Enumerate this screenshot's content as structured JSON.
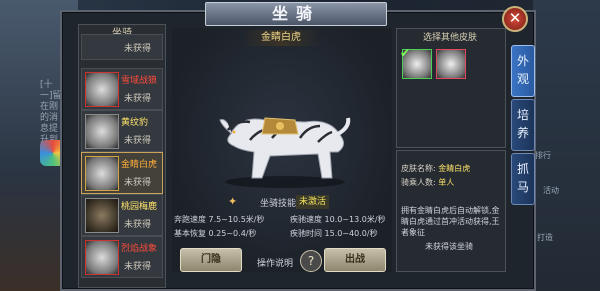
{
  "title": "坐骑",
  "close_label": "✕",
  "list": {
    "header": "坐骑",
    "items": [
      {
        "name": "",
        "status": "未获得",
        "frame": ""
      },
      {
        "name": "雪域战狼",
        "status": "未获得",
        "frame": "red",
        "name_color": "n-red"
      },
      {
        "name": "黄纹豹",
        "status": "未获得",
        "frame": "",
        "name_color": "n-yellow"
      },
      {
        "name": "金睛白虎",
        "status": "未获得",
        "frame": "gold",
        "name_color": "n-orange",
        "selected": true
      },
      {
        "name": "桃园梅鹿",
        "status": "未获得",
        "frame": "dark",
        "name_color": "n-yellow"
      },
      {
        "name": "烈焰战象",
        "status": "未获得",
        "frame": "red",
        "name_color": "n-red"
      }
    ]
  },
  "preview": {
    "mount_name": "金睛白虎",
    "skill_label": "坐骑技能",
    "skill_state": "未激活"
  },
  "stats": {
    "run_speed": "奔跑速度 7.5~10.5米/秒",
    "dash_speed": "疾驰速度 10.0~13.0米/秒",
    "base_recover": "基本恢复 0.25~0.4/秒",
    "dash_time": "疾驰时间 15.0~40.0/秒"
  },
  "buttons": {
    "hide": "门隐",
    "help": "操作说明",
    "help_icon": "?",
    "ride": "出战"
  },
  "skins": {
    "header": "选择其他皮肤",
    "check": "✔"
  },
  "info": {
    "skin_name_label": "皮肤名称:",
    "skin_name": "金睛白虎",
    "riders_label": "骑乘人数:",
    "riders": "单人",
    "desc": "拥有金睛白虎后自动解锁,金睛白虎通过首冲活动获得,王者象征",
    "bottom": "未获得该坐骑"
  },
  "tabs": [
    "外观",
    "培养",
    "抓马"
  ],
  "left_chat": "[十一]留在刚的消息提升到",
  "right_labels": [
    "排行",
    "活动",
    "打造"
  ]
}
